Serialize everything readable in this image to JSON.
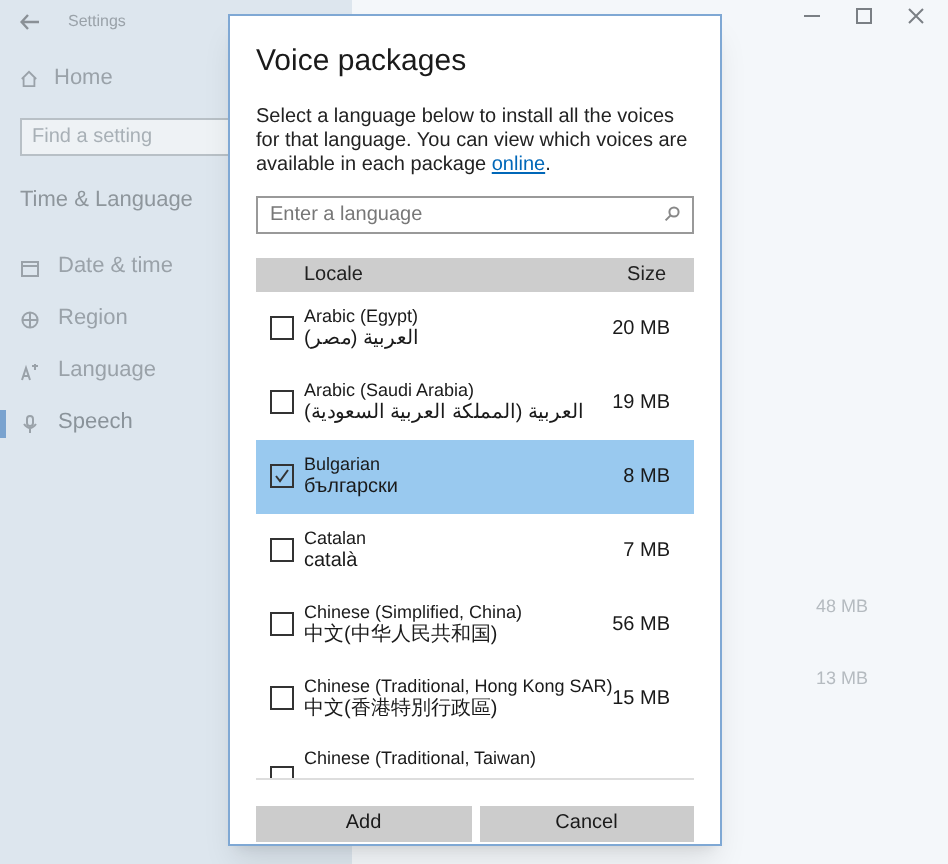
{
  "settings": {
    "title": "Settings",
    "home": "Home",
    "search_placeholder": "Find a setting",
    "section": "Time & Language",
    "nav": [
      {
        "label": "Date & time",
        "selected": false
      },
      {
        "label": "Region",
        "selected": false
      },
      {
        "label": "Language",
        "selected": false
      },
      {
        "label": "Speech",
        "selected": true
      }
    ],
    "background_sizes": [
      "48 MB",
      "13 MB"
    ]
  },
  "dialog": {
    "title": "Voice packages",
    "description_before": "Select a language below to install all the voices for that language. You can view which voices are available in each package ",
    "link": "online",
    "description_after": ".",
    "search_placeholder": "Enter a language",
    "columns": [
      "Locale",
      "Size"
    ],
    "rows": [
      {
        "name": "Arabic (Egypt)",
        "native": "العربية (مصر)",
        "size": "20 MB",
        "checked": false,
        "selected": false
      },
      {
        "name": "Arabic (Saudi Arabia)",
        "native": "العربية (المملكة العربية السعودية)",
        "size": "19 MB",
        "checked": false,
        "selected": false
      },
      {
        "name": "Bulgarian",
        "native": "български",
        "size": "8 MB",
        "checked": true,
        "selected": true
      },
      {
        "name": "Catalan",
        "native": "català",
        "size": "7 MB",
        "checked": false,
        "selected": false
      },
      {
        "name": "Chinese (Simplified, China)",
        "native": "中文(中华人民共和国)",
        "size": "56 MB",
        "checked": false,
        "selected": false
      },
      {
        "name": "Chinese (Traditional, Hong Kong SAR)",
        "native": "中文(香港特別行政區)",
        "size": "15 MB",
        "checked": false,
        "selected": false
      },
      {
        "name": "Chinese (Traditional, Taiwan)",
        "checked": false,
        "selected": false
      }
    ],
    "buttons": [
      "Add",
      "Cancel"
    ]
  }
}
